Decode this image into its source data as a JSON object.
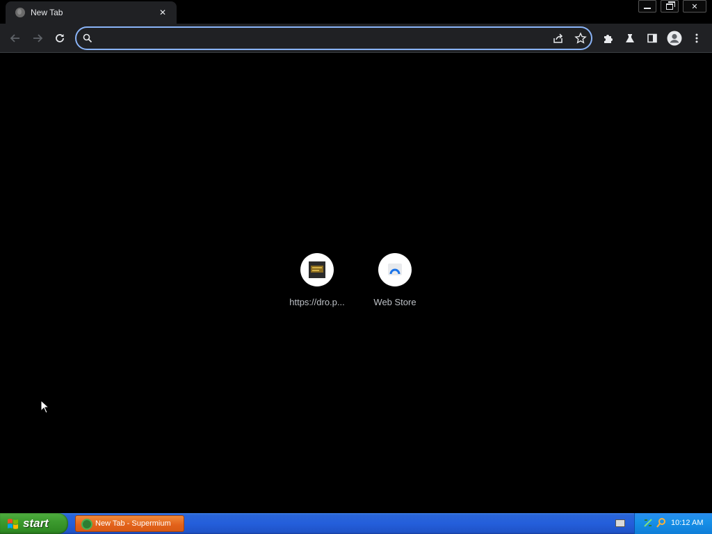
{
  "tab": {
    "title": "New Tab",
    "close_glyph": "✕"
  },
  "window_controls": {
    "minimize": "minimize-icon",
    "restore": "restore-icon",
    "close_glyph": "✕"
  },
  "toolbar": {
    "back": "back-arrow-icon",
    "forward": "forward-arrow-icon",
    "reload": "reload-icon",
    "omnibox_value": "",
    "omnibox_placeholder": "",
    "share": "share-icon",
    "bookmark": "star-icon",
    "extensions": "puzzle-icon",
    "labs": "flask-icon",
    "side_panel": "side-panel-icon",
    "profile": "profile-avatar-icon",
    "menu": "more-vert-icon"
  },
  "shortcuts": [
    {
      "label": "https://dro.p..."
    },
    {
      "label": "Web Store"
    }
  ],
  "taskbar": {
    "start_label": "start",
    "task_item_label": "New Tab - Supermium",
    "clock": "10:12 AM"
  },
  "colors": {
    "focus_ring": "#8ab4f8",
    "toolbar_bg": "#202124",
    "taskbar_blue": "#245edb",
    "start_green": "#3c9a2e"
  }
}
